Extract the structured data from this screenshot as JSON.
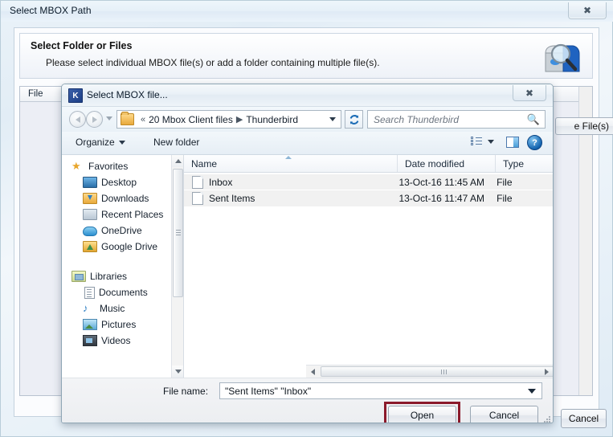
{
  "main_window": {
    "title": "Select MBOX Path",
    "close_label": "✕",
    "header": {
      "title": "Select Folder or Files",
      "subtitle": "Please select individual MBOX file(s) or add a folder containing multiple file(s).",
      "icon": "mailbox-search-icon"
    },
    "list": {
      "column_file": "File"
    },
    "add_files_button": "e File(s)",
    "cancel_button": "Cancel"
  },
  "file_dialog": {
    "title": "Select MBOX file...",
    "app_icon_letter": "K",
    "close_label": "✕",
    "address": {
      "folder_icon": "folder-icon",
      "overflow_chevron": "«",
      "segments": [
        "20 Mbox Client files",
        "Thunderbird"
      ],
      "separator": "▶",
      "dropdown_icon": "chevron-down-icon",
      "refresh_icon": "refresh-icon"
    },
    "search": {
      "placeholder": "Search Thunderbird",
      "icon": "search-icon"
    },
    "toolbar": {
      "organize": "Organize",
      "new_folder": "New folder",
      "view_icon": "list-view-icon",
      "preview_icon": "preview-pane-icon",
      "help_icon": "help-icon",
      "help_label": "?"
    },
    "sidebar": {
      "groups": [
        {
          "label": "Favorites",
          "icon": "star-icon",
          "items": [
            {
              "label": "Desktop",
              "icon": "desktop-icon"
            },
            {
              "label": "Downloads",
              "icon": "downloads-icon"
            },
            {
              "label": "Recent Places",
              "icon": "recent-places-icon"
            },
            {
              "label": "OneDrive",
              "icon": "onedrive-icon"
            },
            {
              "label": "Google Drive",
              "icon": "google-drive-icon"
            }
          ]
        },
        {
          "label": "Libraries",
          "icon": "libraries-icon",
          "items": [
            {
              "label": "Documents",
              "icon": "documents-icon"
            },
            {
              "label": "Music",
              "icon": "music-icon"
            },
            {
              "label": "Pictures",
              "icon": "pictures-icon"
            },
            {
              "label": "Videos",
              "icon": "videos-icon"
            }
          ]
        }
      ]
    },
    "file_list": {
      "columns": [
        "Name",
        "Date modified",
        "Type"
      ],
      "sort_column": "Name",
      "sort_direction": "ascending",
      "rows": [
        {
          "name": "Inbox",
          "date_modified": "13-Oct-16 11:45 AM",
          "type": "File",
          "selected": true
        },
        {
          "name": "Sent Items",
          "date_modified": "13-Oct-16 11:47 AM",
          "type": "File",
          "selected": true
        }
      ]
    },
    "footer": {
      "file_name_label": "File name:",
      "file_name_value": "\"Sent Items\" \"Inbox\"",
      "open_button": "Open",
      "cancel_button": "Cancel",
      "highlight_color": "#8b1a2b",
      "highlighted_control": "Open"
    }
  }
}
